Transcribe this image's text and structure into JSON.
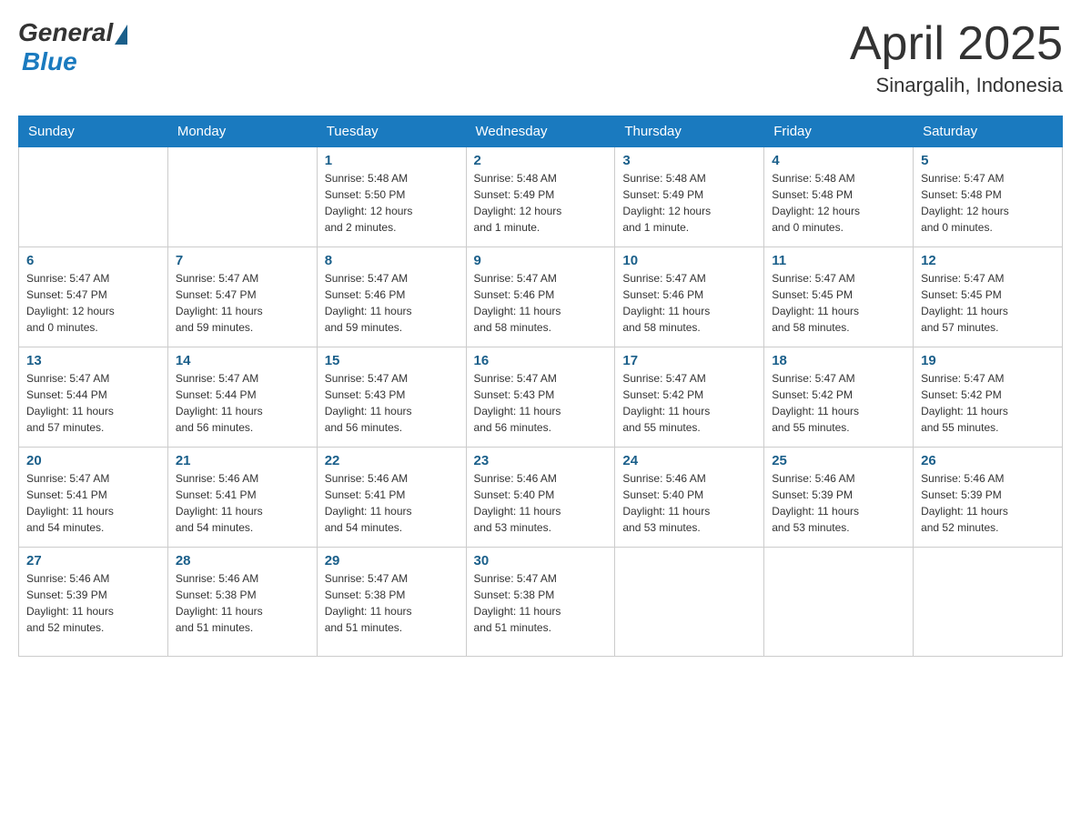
{
  "header": {
    "logo_general": "General",
    "logo_blue": "Blue",
    "month_year": "April 2025",
    "location": "Sinargalih, Indonesia"
  },
  "weekdays": [
    "Sunday",
    "Monday",
    "Tuesday",
    "Wednesday",
    "Thursday",
    "Friday",
    "Saturday"
  ],
  "weeks": [
    [
      {
        "day": "",
        "info": ""
      },
      {
        "day": "",
        "info": ""
      },
      {
        "day": "1",
        "info": "Sunrise: 5:48 AM\nSunset: 5:50 PM\nDaylight: 12 hours\nand 2 minutes."
      },
      {
        "day": "2",
        "info": "Sunrise: 5:48 AM\nSunset: 5:49 PM\nDaylight: 12 hours\nand 1 minute."
      },
      {
        "day": "3",
        "info": "Sunrise: 5:48 AM\nSunset: 5:49 PM\nDaylight: 12 hours\nand 1 minute."
      },
      {
        "day": "4",
        "info": "Sunrise: 5:48 AM\nSunset: 5:48 PM\nDaylight: 12 hours\nand 0 minutes."
      },
      {
        "day": "5",
        "info": "Sunrise: 5:47 AM\nSunset: 5:48 PM\nDaylight: 12 hours\nand 0 minutes."
      }
    ],
    [
      {
        "day": "6",
        "info": "Sunrise: 5:47 AM\nSunset: 5:47 PM\nDaylight: 12 hours\nand 0 minutes."
      },
      {
        "day": "7",
        "info": "Sunrise: 5:47 AM\nSunset: 5:47 PM\nDaylight: 11 hours\nand 59 minutes."
      },
      {
        "day": "8",
        "info": "Sunrise: 5:47 AM\nSunset: 5:46 PM\nDaylight: 11 hours\nand 59 minutes."
      },
      {
        "day": "9",
        "info": "Sunrise: 5:47 AM\nSunset: 5:46 PM\nDaylight: 11 hours\nand 58 minutes."
      },
      {
        "day": "10",
        "info": "Sunrise: 5:47 AM\nSunset: 5:46 PM\nDaylight: 11 hours\nand 58 minutes."
      },
      {
        "day": "11",
        "info": "Sunrise: 5:47 AM\nSunset: 5:45 PM\nDaylight: 11 hours\nand 58 minutes."
      },
      {
        "day": "12",
        "info": "Sunrise: 5:47 AM\nSunset: 5:45 PM\nDaylight: 11 hours\nand 57 minutes."
      }
    ],
    [
      {
        "day": "13",
        "info": "Sunrise: 5:47 AM\nSunset: 5:44 PM\nDaylight: 11 hours\nand 57 minutes."
      },
      {
        "day": "14",
        "info": "Sunrise: 5:47 AM\nSunset: 5:44 PM\nDaylight: 11 hours\nand 56 minutes."
      },
      {
        "day": "15",
        "info": "Sunrise: 5:47 AM\nSunset: 5:43 PM\nDaylight: 11 hours\nand 56 minutes."
      },
      {
        "day": "16",
        "info": "Sunrise: 5:47 AM\nSunset: 5:43 PM\nDaylight: 11 hours\nand 56 minutes."
      },
      {
        "day": "17",
        "info": "Sunrise: 5:47 AM\nSunset: 5:42 PM\nDaylight: 11 hours\nand 55 minutes."
      },
      {
        "day": "18",
        "info": "Sunrise: 5:47 AM\nSunset: 5:42 PM\nDaylight: 11 hours\nand 55 minutes."
      },
      {
        "day": "19",
        "info": "Sunrise: 5:47 AM\nSunset: 5:42 PM\nDaylight: 11 hours\nand 55 minutes."
      }
    ],
    [
      {
        "day": "20",
        "info": "Sunrise: 5:47 AM\nSunset: 5:41 PM\nDaylight: 11 hours\nand 54 minutes."
      },
      {
        "day": "21",
        "info": "Sunrise: 5:46 AM\nSunset: 5:41 PM\nDaylight: 11 hours\nand 54 minutes."
      },
      {
        "day": "22",
        "info": "Sunrise: 5:46 AM\nSunset: 5:41 PM\nDaylight: 11 hours\nand 54 minutes."
      },
      {
        "day": "23",
        "info": "Sunrise: 5:46 AM\nSunset: 5:40 PM\nDaylight: 11 hours\nand 53 minutes."
      },
      {
        "day": "24",
        "info": "Sunrise: 5:46 AM\nSunset: 5:40 PM\nDaylight: 11 hours\nand 53 minutes."
      },
      {
        "day": "25",
        "info": "Sunrise: 5:46 AM\nSunset: 5:39 PM\nDaylight: 11 hours\nand 53 minutes."
      },
      {
        "day": "26",
        "info": "Sunrise: 5:46 AM\nSunset: 5:39 PM\nDaylight: 11 hours\nand 52 minutes."
      }
    ],
    [
      {
        "day": "27",
        "info": "Sunrise: 5:46 AM\nSunset: 5:39 PM\nDaylight: 11 hours\nand 52 minutes."
      },
      {
        "day": "28",
        "info": "Sunrise: 5:46 AM\nSunset: 5:38 PM\nDaylight: 11 hours\nand 51 minutes."
      },
      {
        "day": "29",
        "info": "Sunrise: 5:47 AM\nSunset: 5:38 PM\nDaylight: 11 hours\nand 51 minutes."
      },
      {
        "day": "30",
        "info": "Sunrise: 5:47 AM\nSunset: 5:38 PM\nDaylight: 11 hours\nand 51 minutes."
      },
      {
        "day": "",
        "info": ""
      },
      {
        "day": "",
        "info": ""
      },
      {
        "day": "",
        "info": ""
      }
    ]
  ]
}
